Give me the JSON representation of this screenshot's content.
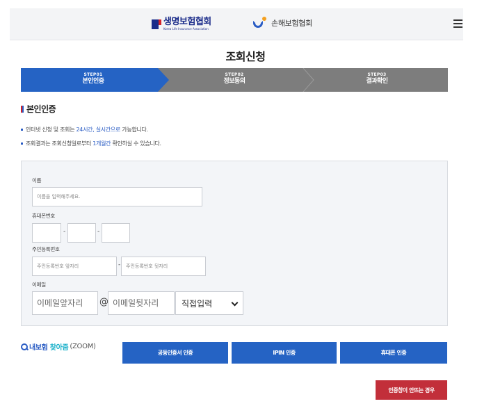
{
  "header": {
    "logo1_text": "생명보험협회",
    "logo1_sub": "Korea Life Insurance Association",
    "logo2_text": "손해보험협회",
    "menu_icon": "hamburger-menu-icon"
  },
  "page_title": "조회신청",
  "steps": [
    {
      "no": "STEP01",
      "name": "본인인증",
      "active": true
    },
    {
      "no": "STEP02",
      "name": "정보동의",
      "active": false
    },
    {
      "no": "STEP03",
      "name": "결과확인",
      "active": false
    }
  ],
  "section_title": "본인인증",
  "notices": [
    {
      "pre": "인터넷 신청 및 조회는 ",
      "hl": "24시간, 실시간으로",
      "post": " 가능합니다."
    },
    {
      "pre": "조회결과는 조회신청일로부터 ",
      "hl": "1개월간",
      "post": " 확인하실 수 있습니다."
    }
  ],
  "form": {
    "name_label": "이름",
    "name_placeholder": "이름을 입력해주세요.",
    "phone_label": "휴대폰번호",
    "phone_sep": "-",
    "rrn_label": "주민등록번호",
    "rrn_front_placeholder": "주민등록번호 앞자리",
    "rrn_back_placeholder": "주민등록번호 뒷자리",
    "email_label": "이메일",
    "email_front_placeholder": "이메일앞자리",
    "email_at": "@",
    "email_back_placeholder": "이메일뒷자리",
    "email_domain_selected": "직접입력"
  },
  "zoom": {
    "part1": "내보험",
    "part2": "찾아줌",
    "part3": "(ZOOM)"
  },
  "buttons": {
    "cert": "공동인증서 인증",
    "ipin": "IPIN 인증",
    "phone": "휴대폰 인증",
    "no_auth": "인증창이 안뜨는 경우"
  },
  "colors": {
    "accent": "#2563c4",
    "step_inactive": "#7d7d7d",
    "danger": "#c22f3a"
  }
}
